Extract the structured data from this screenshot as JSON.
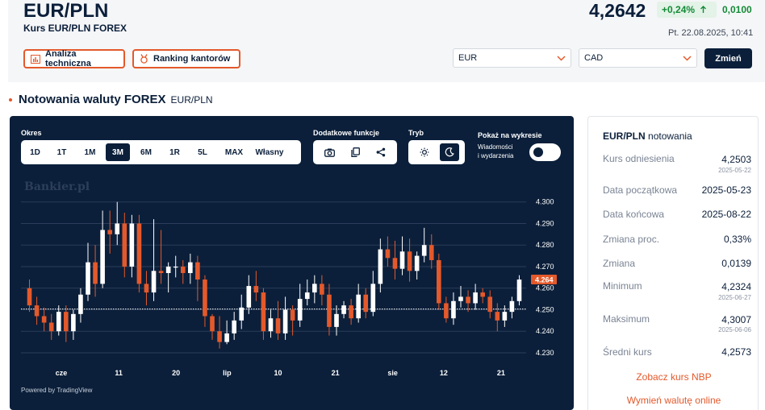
{
  "header": {
    "pair": "EUR/PLN",
    "subtitle": "Kurs EUR/PLN FOREX",
    "rate": "4,2642",
    "change_pct": "+0,24%",
    "change_abs": "0,0100",
    "datetime": "Pt. 22.08.2025, 10:41"
  },
  "actions": {
    "technical_label": "Analiza techniczna",
    "ranking_label": "Ranking kantorów"
  },
  "converter": {
    "from_value": "EUR",
    "to_value": "CAD",
    "submit_label": "Zmień"
  },
  "section": {
    "title": "Notowania waluty FOREX",
    "pair": "EUR/PLN"
  },
  "chart_panel": {
    "period_label": "Okres",
    "periods": [
      "1D",
      "1T",
      "1M",
      "3M",
      "6M",
      "1R",
      "5L",
      "MAX",
      "Własny"
    ],
    "active_period": "3M",
    "extra_label": "Dodatkowe funkcje",
    "mode_label": "Tryb",
    "events_label": "Pokaż na wykresie",
    "events_sub1": "Wiadomości",
    "events_sub2": "i wydarzenia",
    "watermark": "Bankier.pl",
    "powered": "Powered by TradingView",
    "colors": {
      "bg": "#0b1f3a",
      "up": "#ffffff",
      "down": "#e4592b",
      "grid": "#2b3d5a"
    }
  },
  "chart_data": {
    "type": "candlestick",
    "ylim": [
      4.227,
      4.307
    ],
    "y_ticks": [
      "4.300",
      "4.290",
      "4.280",
      "4.270",
      "4.260",
      "4.250",
      "4.240",
      "4.230"
    ],
    "x_ticks": [
      "cze",
      "11",
      "20",
      "lip",
      "10",
      "21",
      "sie",
      "12",
      "21"
    ],
    "last_price": "4.264",
    "reference_line": 4.2503,
    "candles": [
      [
        4.26,
        4.252,
        4.264,
        4.249
      ],
      [
        4.252,
        4.247,
        4.256,
        4.243
      ],
      [
        4.247,
        4.244,
        4.251,
        4.24
      ],
      [
        4.244,
        4.24,
        4.248,
        4.236
      ],
      [
        4.24,
        4.249,
        4.252,
        4.238
      ],
      [
        4.249,
        4.24,
        4.252,
        4.235
      ],
      [
        4.24,
        4.248,
        4.25,
        4.236
      ],
      [
        4.248,
        4.257,
        4.26,
        4.244
      ],
      [
        4.257,
        4.272,
        4.281,
        4.254
      ],
      [
        4.272,
        4.262,
        4.28,
        4.256
      ],
      [
        4.262,
        4.287,
        4.296,
        4.26
      ],
      [
        4.287,
        4.285,
        4.296,
        4.276
      ],
      [
        4.285,
        4.29,
        4.3,
        4.28
      ],
      [
        4.29,
        4.27,
        4.295,
        4.265
      ],
      [
        4.27,
        4.29,
        4.294,
        4.265
      ],
      [
        4.29,
        4.262,
        4.294,
        4.258
      ],
      [
        4.262,
        4.258,
        4.268,
        4.252
      ],
      [
        4.258,
        4.268,
        4.292,
        4.254
      ],
      [
        4.268,
        4.267,
        4.287,
        4.262
      ],
      [
        4.267,
        4.27,
        4.272,
        4.258
      ],
      [
        4.27,
        4.27,
        4.275,
        4.265
      ],
      [
        4.27,
        4.267,
        4.273,
        4.262
      ],
      [
        4.267,
        4.272,
        4.276,
        4.262
      ],
      [
        4.272,
        4.264,
        4.275,
        4.254
      ],
      [
        4.264,
        4.247,
        4.266,
        4.242
      ],
      [
        4.247,
        4.24,
        4.248,
        4.236
      ],
      [
        4.24,
        4.235,
        4.247,
        4.232
      ],
      [
        4.235,
        4.239,
        4.245,
        4.234
      ],
      [
        4.239,
        4.245,
        4.249,
        4.236
      ],
      [
        4.245,
        4.251,
        4.257,
        4.241
      ],
      [
        4.251,
        4.261,
        4.266,
        4.248
      ],
      [
        4.261,
        4.258,
        4.268,
        4.254
      ],
      [
        4.258,
        4.24,
        4.26,
        4.236
      ],
      [
        4.24,
        4.246,
        4.25,
        4.237
      ],
      [
        4.246,
        4.239,
        4.254,
        4.236
      ],
      [
        4.239,
        4.25,
        4.256,
        4.236
      ],
      [
        4.25,
        4.245,
        4.252,
        4.238
      ],
      [
        4.245,
        4.255,
        4.262,
        4.242
      ],
      [
        4.255,
        4.258,
        4.264,
        4.252
      ],
      [
        4.258,
        4.262,
        4.266,
        4.253
      ],
      [
        4.262,
        4.257,
        4.266,
        4.252
      ],
      [
        4.257,
        4.242,
        4.262,
        4.238
      ],
      [
        4.242,
        4.248,
        4.252,
        4.238
      ],
      [
        4.248,
        4.252,
        4.254,
        4.246
      ],
      [
        4.252,
        4.246,
        4.255,
        4.243
      ],
      [
        4.246,
        4.257,
        4.262,
        4.244
      ],
      [
        4.257,
        4.249,
        4.26,
        4.246
      ],
      [
        4.249,
        4.262,
        4.268,
        4.247
      ],
      [
        4.262,
        4.278,
        4.283,
        4.258
      ],
      [
        4.278,
        4.274,
        4.284,
        4.27
      ],
      [
        4.274,
        4.269,
        4.282,
        4.264
      ],
      [
        4.269,
        4.277,
        4.284,
        4.266
      ],
      [
        4.277,
        4.268,
        4.283,
        4.263
      ],
      [
        4.268,
        4.275,
        4.277,
        4.264
      ],
      [
        4.275,
        4.28,
        4.288,
        4.272
      ],
      [
        4.28,
        4.273,
        4.285,
        4.269
      ],
      [
        4.273,
        4.253,
        4.276,
        4.25
      ],
      [
        4.253,
        4.246,
        4.256,
        4.244
      ],
      [
        4.246,
        4.254,
        4.258,
        4.243
      ],
      [
        4.254,
        4.256,
        4.261,
        4.251
      ],
      [
        4.256,
        4.253,
        4.259,
        4.249
      ],
      [
        4.253,
        4.258,
        4.262,
        4.25
      ],
      [
        4.258,
        4.256,
        4.26,
        4.253
      ],
      [
        4.256,
        4.249,
        4.259,
        4.246
      ],
      [
        4.249,
        4.245,
        4.253,
        4.24
      ],
      [
        4.245,
        4.249,
        4.252,
        4.242
      ],
      [
        4.249,
        4.254,
        4.256,
        4.246
      ],
      [
        4.254,
        4.264,
        4.266,
        4.252
      ]
    ]
  },
  "stats": {
    "title_pair": "EUR/PLN",
    "title_suffix": "notowania",
    "rows": [
      {
        "label": "Kurs odniesienia",
        "value": "4,2503",
        "date": "2025-05-22"
      },
      {
        "label": "Data początkowa",
        "value": "2025-05-23"
      },
      {
        "label": "Data końcowa",
        "value": "2025-08-22"
      },
      {
        "label": "Zmiana proc.",
        "value": "0,33%"
      },
      {
        "label": "Zmiana",
        "value": "0,0139"
      },
      {
        "label": "Minimum",
        "value": "4,2324",
        "date": "2025-06-27"
      },
      {
        "label": "Maksimum",
        "value": "4,3007",
        "date": "2025-06-06"
      },
      {
        "label": "Średni kurs",
        "value": "4,2573"
      }
    ],
    "link_nbp": "Zobacz kurs NBP",
    "link_exchange": "Wymień walutę online"
  }
}
